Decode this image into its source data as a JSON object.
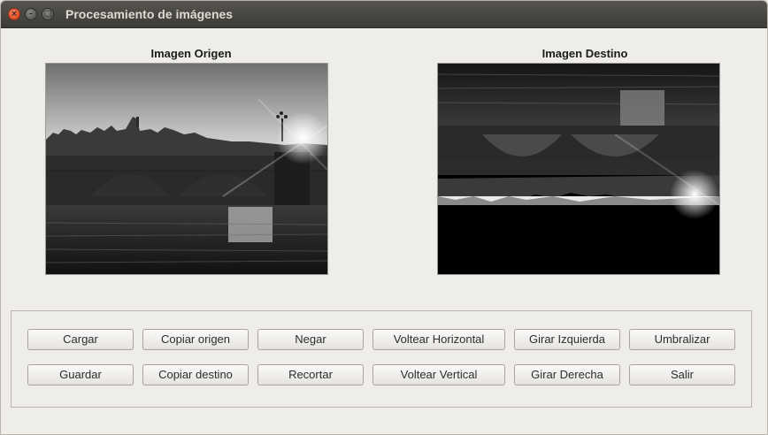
{
  "window": {
    "title": "Procesamiento de imágenes",
    "controls": [
      "close",
      "minimize",
      "maximize"
    ]
  },
  "images": {
    "source_label": "Imagen Origen",
    "dest_label": "Imagen Destino"
  },
  "buttons": {
    "row1": [
      "Cargar",
      "Copiar origen",
      "Negar",
      "Voltear Horizontal",
      "Girar Izquierda",
      "Umbralizar"
    ],
    "row2": [
      "Guardar",
      "Copiar destino",
      "Recortar",
      "Voltear Vertical",
      "Girar Derecha",
      "Salir"
    ]
  }
}
